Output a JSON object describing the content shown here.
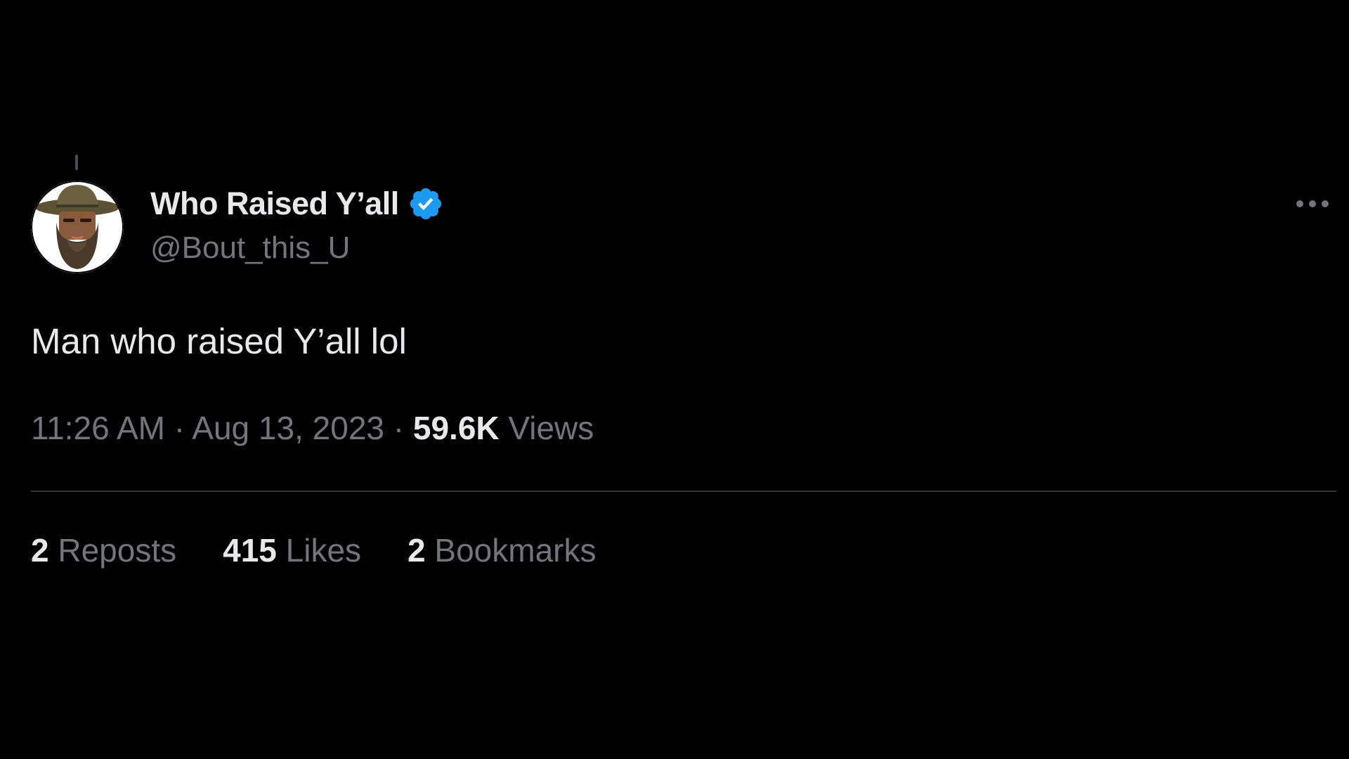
{
  "tweet": {
    "author": {
      "display_name": "Who Raised Y’all",
      "handle": "@Bout_this_U",
      "verified": true,
      "avatar_icon": "avatar-cartoon-hat-beard"
    },
    "text": "Man who raised Y’all lol",
    "time": "11:26 AM",
    "date": "Aug 13, 2023",
    "separator": "·",
    "views_count": "59.6K",
    "views_label": "Views"
  },
  "stats": {
    "reposts_count": "2",
    "reposts_label": "Reposts",
    "likes_count": "415",
    "likes_label": "Likes",
    "bookmarks_count": "2",
    "bookmarks_label": "Bookmarks"
  },
  "icons": {
    "verified": "verified-badge-icon",
    "more": "more-options-icon"
  },
  "colors": {
    "background": "#000000",
    "primary_text": "#e7e9ea",
    "secondary_text": "#71767b",
    "divider": "#2f3336",
    "verified_blue": "#1d9bf0"
  }
}
